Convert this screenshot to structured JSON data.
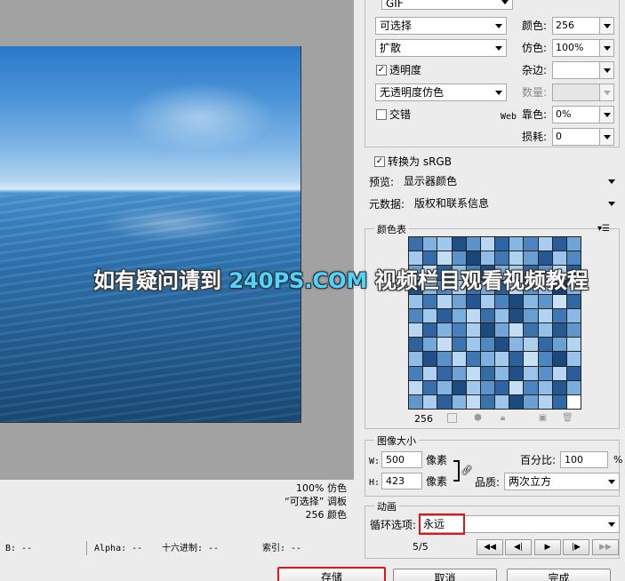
{
  "preview": {
    "info_lines": [
      "100% 仿色",
      "“可选择” 调板",
      "256 颜色"
    ]
  },
  "watermark": {
    "part1": "如有疑问请到 ",
    "part2": "240PS.COM",
    "part3": " 视频栏目观看视频教程"
  },
  "settings": {
    "format": "GIF",
    "palette": "可选择",
    "dither_algo": "扩散",
    "transparency_label": "透明度",
    "transparency_checked": true,
    "transparency_dither": "无透明度仿色",
    "interlaced_label": "交错",
    "interlaced_checked": false,
    "colors_label": "颜色:",
    "colors_value": "256",
    "dither_label": "仿色:",
    "dither_value": "100%",
    "matte_label": "杂边:",
    "matte_value": "",
    "amount_label": "数量:",
    "amount_value": "",
    "web_label": "Web",
    "web_snap_label": "靠色:",
    "web_snap_value": "0%",
    "lossy_label": "损耗:",
    "lossy_value": "0",
    "convert_srgb_label": "转换为 sRGB",
    "convert_srgb_checked": true,
    "preview_label": "预览:",
    "preview_value": "显示器颜色",
    "metadata_label": "元数据:",
    "metadata_value": "版权和联系信息"
  },
  "color_table": {
    "title": "颜色表",
    "count": "256",
    "colors": [
      "#3b6fa8",
      "#7fb2e0",
      "#9fc8ec",
      "#1e4f85",
      "#5b93cb",
      "#b7d7f2",
      "#2d66a4",
      "#86b8e4",
      "#4c85c0",
      "#a9cdef",
      "#2a5d97",
      "#6fa4d6",
      "#a3c9ee",
      "#346ca9",
      "#c2dcf4",
      "#5a92ca",
      "#18477a",
      "#8fbde7",
      "#3f78b4",
      "#b0d2f1",
      "#6a9fd3",
      "#235891",
      "#9ac4eb",
      "#4f88c3",
      "#6ba1d4",
      "#c7e0f6",
      "#2c63a0",
      "#92bfe9",
      "#4883bf",
      "#1c4c80",
      "#7db0df",
      "#a8ccef",
      "#31699f",
      "#5f97cd",
      "#bcd8f3",
      "#275d99",
      "#1f5089",
      "#8cbbe6",
      "#5189c4",
      "#aed0f0",
      "#3a73af",
      "#76abdc",
      "#2b5f98",
      "#c0dbf4",
      "#5d95cc",
      "#9cc6ec",
      "#16437a",
      "#83b5e2",
      "#97c2ea",
      "#3d76b2",
      "#b5d5f2",
      "#6ea3d5",
      "#235793",
      "#a6cbee",
      "#4a84c0",
      "#1a4a7f",
      "#88b9e5",
      "#5c94cb",
      "#cbe2f6",
      "#2f67a3",
      "#4d86c1",
      "#a0c8ed",
      "#2a5f9b",
      "#7ab0de",
      "#bdd9f3",
      "#376fab",
      "#92c0e9",
      "#1d4d83",
      "#66a0d3",
      "#b2d3f1",
      "#3f79b5",
      "#8ab9e5",
      "#b8d6f2",
      "#2e65a1",
      "#80b3e1",
      "#4780bc",
      "#aacdef",
      "#1b4a7e",
      "#71a7d8",
      "#c3ddf5",
      "#3a72ae",
      "#94c1e9",
      "#26598f",
      "#5e96cd",
      "#2c62a0",
      "#73a9da",
      "#c5def5",
      "#3c74b0",
      "#9ec7ec",
      "#5088c3",
      "#1e4e85",
      "#86b7e4",
      "#adcff0",
      "#3069a5",
      "#6aa0d3",
      "#b4d4f1",
      "#8ebce7",
      "#214f8a",
      "#5a91c9",
      "#b9d7f3",
      "#3e77b3",
      "#7fb1e0",
      "#a4caee",
      "#2b619d",
      "#c8e1f6",
      "#4d87c2",
      "#1a477c",
      "#98c3eb",
      "#4580bd",
      "#aed1f0",
      "#2f66a3",
      "#6ca2d4",
      "#c0dcf4",
      "#336ba7",
      "#8ab8e5",
      "#1f508a",
      "#9ac5eb",
      "#5990c8",
      "#b6d5f2",
      "#2a5e9a",
      "#bdd9f3",
      "#3770ac",
      "#83b5e2",
      "#1c4b81",
      "#a2c9ed",
      "#5c93ca",
      "#2e64a2",
      "#c6dff6",
      "#4b84c0",
      "#90bee8",
      "#25578f",
      "#78addd",
      "#5f96cc",
      "#a8cdef",
      "#2a5f9c",
      "#86b6e3",
      "#c2dcf4",
      "#3a72ae",
      "#9dc6ec",
      "#1b4a80",
      "#6aa0d3",
      "#b3d4f1",
      "#3069a6",
      "#ffffff"
    ]
  },
  "image_size": {
    "title": "图像大小",
    "w_label": "W:",
    "w_value": "500",
    "h_label": "H:",
    "h_value": "423",
    "unit": "像素",
    "percent_label": "百分比:",
    "percent_value": "100",
    "percent_unit": "%",
    "quality_label": "品质:",
    "quality_value": "两次立方"
  },
  "animation": {
    "title": "动画",
    "loop_label": "循环选项:",
    "loop_value": "永远",
    "frame": "5/5"
  },
  "status_bar": {
    "b": "B: --",
    "alpha": "Alpha: --",
    "hex": "十六进制: --",
    "index": "索引: --"
  },
  "buttons": {
    "save": "存储",
    "cancel": "取消",
    "done": "完成"
  }
}
